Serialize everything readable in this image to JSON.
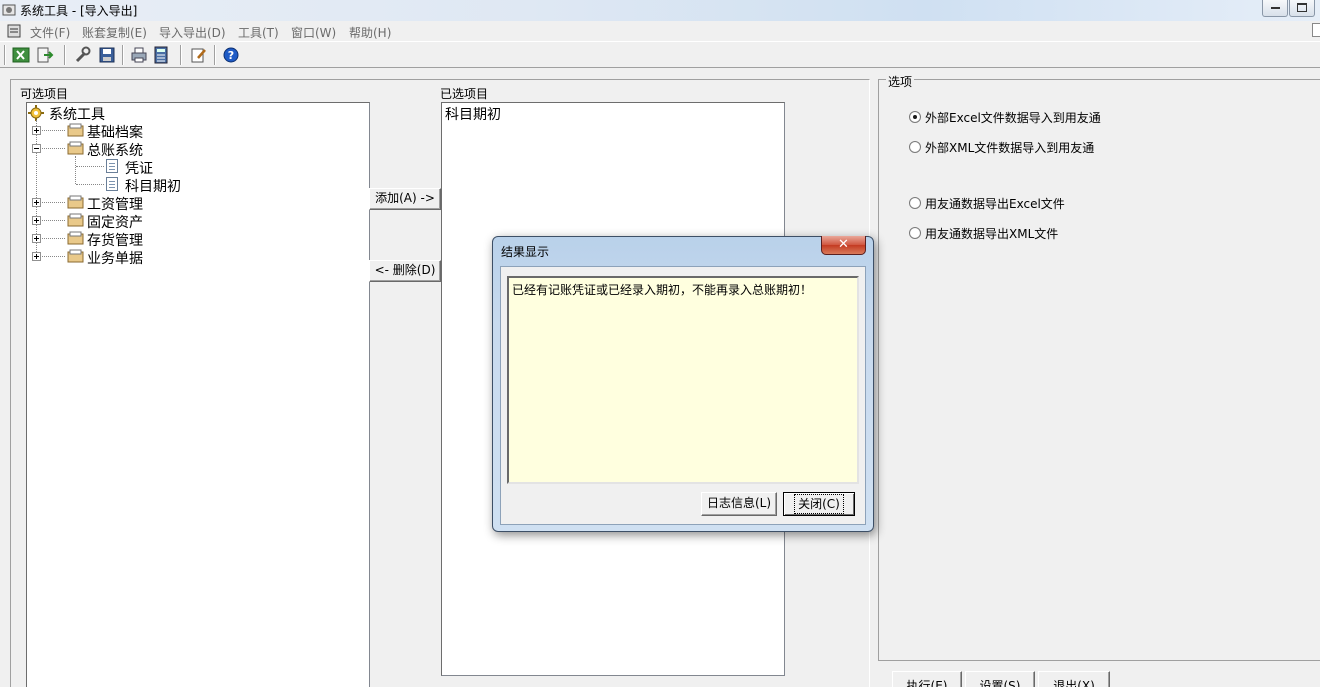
{
  "window": {
    "title": "系统工具 - [导入导出]"
  },
  "menu": [
    "文件(F)",
    "账套复制(E)",
    "导入导出(D)",
    "工具(T)",
    "窗口(W)",
    "帮助(H)"
  ],
  "toolbar_icons": [
    "excel-icon",
    "export-icon",
    "tools-icon",
    "save-icon",
    "print-icon",
    "calculator-icon",
    "edit-icon",
    "help-icon"
  ],
  "available": {
    "label": "可选项目",
    "root": "系统工具",
    "items": [
      {
        "label": "基础档案",
        "expanded": false
      },
      {
        "label": "总账系统",
        "expanded": true,
        "children": [
          "凭证",
          "科目期初"
        ]
      },
      {
        "label": "工资管理",
        "expanded": false
      },
      {
        "label": "固定资产",
        "expanded": false
      },
      {
        "label": "存货管理",
        "expanded": false
      },
      {
        "label": "业务单据",
        "expanded": false
      }
    ]
  },
  "selected": {
    "label": "已选项目",
    "items": [
      "科目期初"
    ]
  },
  "buttons": {
    "add": "添加(A) ->",
    "remove": "<- 删除(D)",
    "execute": "执行(E)",
    "settings": "设置(S)",
    "exit": "退出(X)"
  },
  "options": {
    "label": "选项",
    "radios": [
      {
        "label": "外部Excel文件数据导入到用友通",
        "checked": true
      },
      {
        "label": "外部XML文件数据导入到用友通",
        "checked": false
      },
      {
        "label": "用友通数据导出Excel文件",
        "checked": false
      },
      {
        "label": "用友通数据导出XML文件",
        "checked": false
      }
    ]
  },
  "dialog": {
    "title": "结果显示",
    "message": "已经有记账凭证或已经录入期初，不能再录入总账期初！",
    "log_button": "日志信息(L)",
    "close_button": "关闭(C)"
  },
  "colors": {
    "message_bg": "#ffffdf",
    "dialog_frame": "#c8daee",
    "close_red": "#c43b22"
  }
}
